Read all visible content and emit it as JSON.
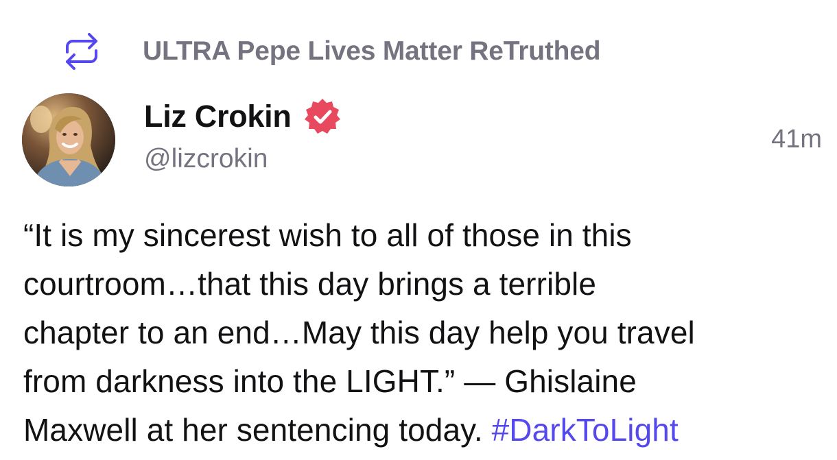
{
  "retruth": {
    "icon": "retruth-arrows-icon",
    "label": "ULTRA Pepe Lives Matter ReTruthed",
    "icon_color": "#5448ee"
  },
  "author": {
    "avatar": "profile-photo",
    "display_name": "Liz Crokin",
    "verified_icon": "verified-badge-icon",
    "verified_color": "#e8495f",
    "handle": "@lizcrokin"
  },
  "post": {
    "timestamp": "41m",
    "lines": [
      "“It is my sincerest wish to all of those in this",
      "courtroom…that this day brings a terrible",
      "chapter to an end…May this day help you travel",
      "from darkness into the LIGHT.” — Ghislaine",
      "Maxwell at her sentencing today. "
    ],
    "hashtag": "#DarkToLight",
    "hashtag_color": "#5448ee"
  }
}
